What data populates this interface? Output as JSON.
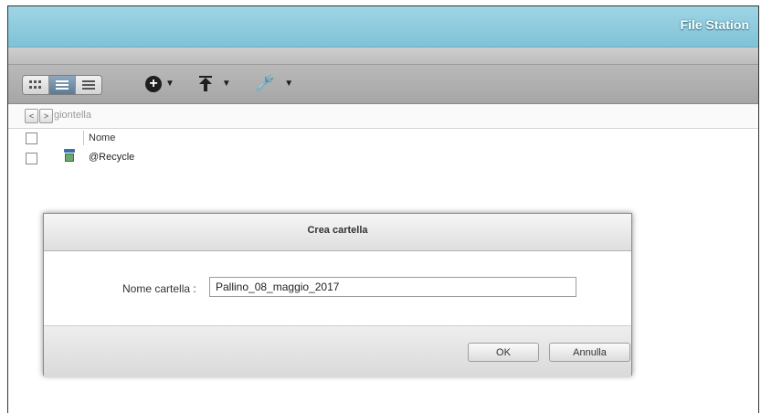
{
  "app": {
    "title": "File Station"
  },
  "toolbar": {
    "view_buttons": [
      "thumbnail-view",
      "list-view",
      "details-view"
    ],
    "tools": [
      "create-folder",
      "upload",
      "tools"
    ]
  },
  "path": {
    "back": "<",
    "forward": ">",
    "current": "giontella"
  },
  "list": {
    "column_name": "Nome",
    "rows": [
      {
        "name": "@Recycle",
        "icon": "recycle-bin-icon"
      }
    ]
  },
  "dialog": {
    "title": "Crea cartella",
    "field_label": "Nome cartella :",
    "field_value": "Pallino_08_maggio_2017",
    "ok_label": "OK",
    "cancel_label": "Annulla"
  }
}
